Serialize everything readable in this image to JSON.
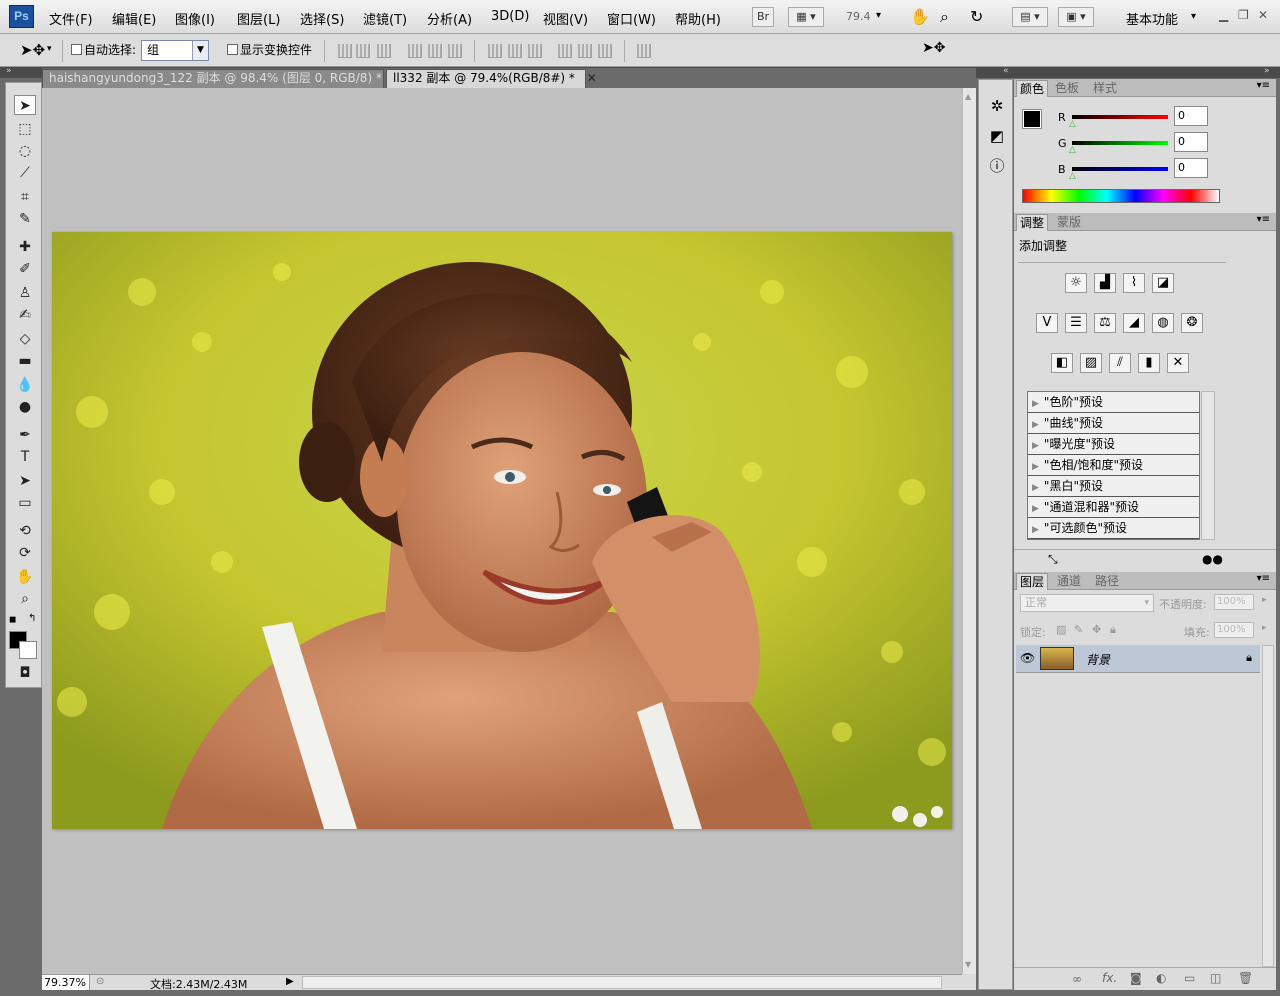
{
  "app": {
    "logo": "Ps"
  },
  "menu": {
    "items": [
      "文件(F)",
      "编辑(E)",
      "图像(I)",
      "图层(L)",
      "选择(S)",
      "滤镜(T)",
      "分析(A)",
      "3D(D)",
      "视图(V)",
      "窗口(W)",
      "帮助(H)"
    ],
    "bridge": "Br",
    "zoom": "79.4",
    "workspace": "基本功能"
  },
  "options": {
    "auto_select_label": "自动选择:",
    "auto_select_value": "组",
    "show_transform_label": "显示变换控件"
  },
  "tabs": [
    {
      "label": "haishangyundong3_122 副本 @ 98.4% (图层 0, RGB/8) *",
      "active": false
    },
    {
      "label": "ll332 副本 @ 79.4%(RGB/8#) *",
      "active": true
    }
  ],
  "status": {
    "zoom": "79.37%",
    "doc": "文档:2.43M/2.43M"
  },
  "color_panel": {
    "tabs": [
      "颜色",
      "色板",
      "样式"
    ],
    "r_label": "R",
    "g_label": "G",
    "b_label": "B",
    "r": "0",
    "g": "0",
    "b": "0"
  },
  "adjust_panel": {
    "tabs": [
      "调整",
      "蒙版"
    ],
    "title": "添加调整",
    "presets": [
      "\"色阶\"预设",
      "\"曲线\"预设",
      "\"曝光度\"预设",
      "\"色相/饱和度\"预设",
      "\"黑白\"预设",
      "\"通道混和器\"预设",
      "\"可选颜色\"预设"
    ]
  },
  "layers_panel": {
    "tabs": [
      "图层",
      "通道",
      "路径"
    ],
    "blend_mode": "正常",
    "opacity_label": "不透明度:",
    "opacity": "100%",
    "lock_label": "锁定:",
    "fill_label": "填充:",
    "fill": "100%",
    "layer_name": "背景",
    "fx": "fx."
  }
}
